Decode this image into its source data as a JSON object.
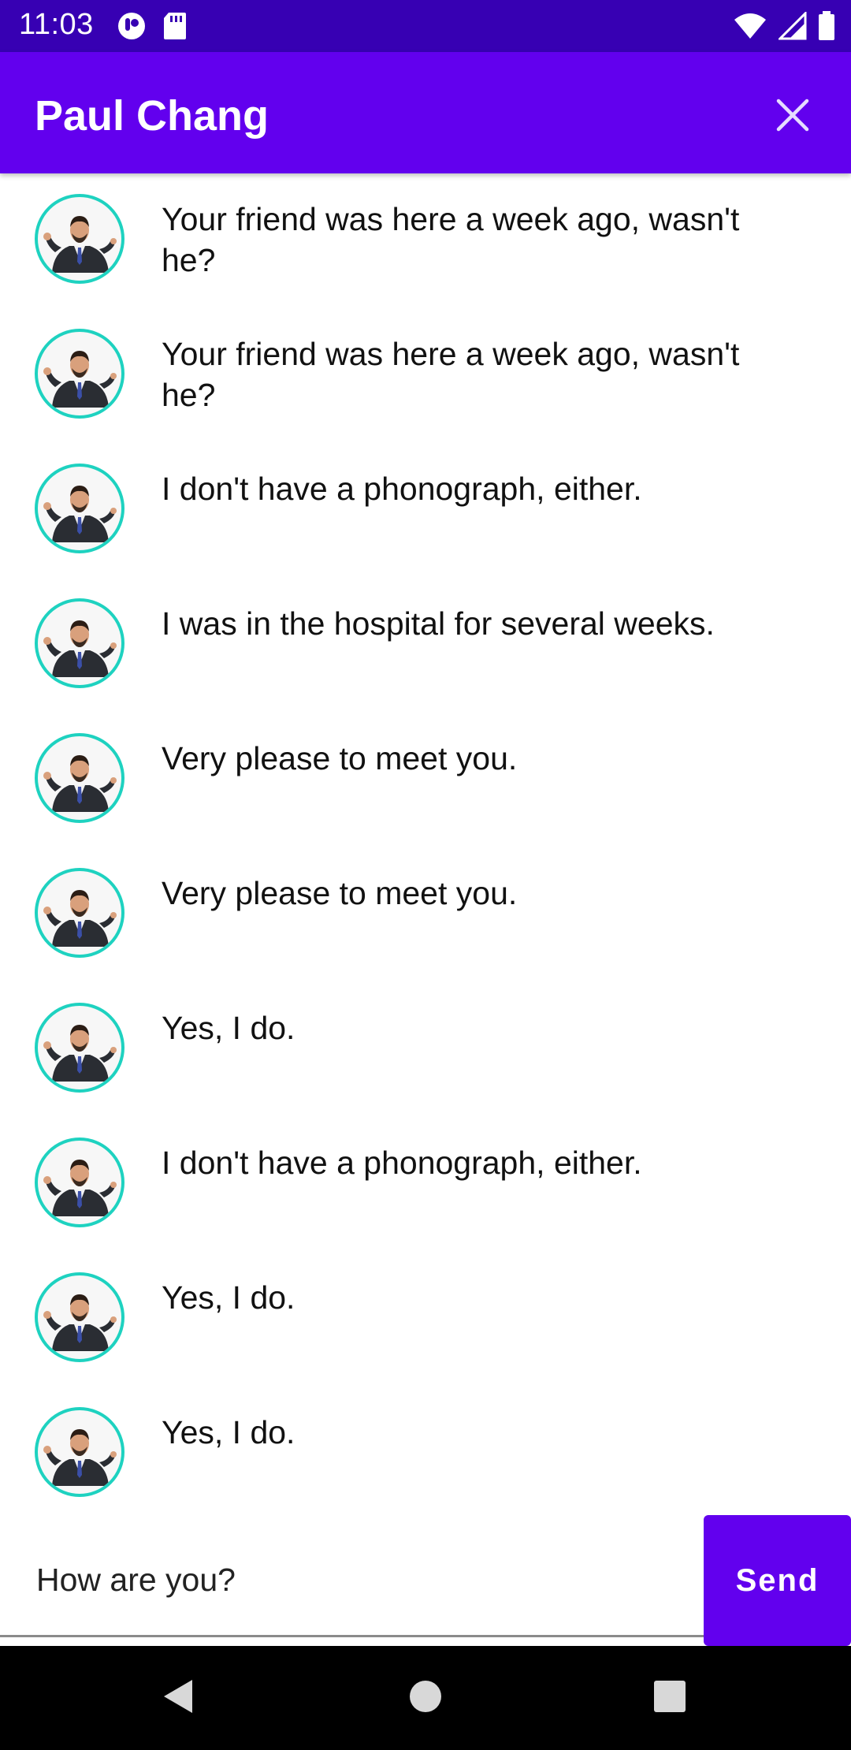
{
  "status_bar": {
    "time": "11:03",
    "left_icons": [
      "notification-app-icon",
      "sd-card-icon"
    ],
    "right_icons": [
      "wifi-icon",
      "signal-icon",
      "battery-icon"
    ]
  },
  "app_bar": {
    "title": "Paul Chang",
    "close_icon": "close-icon",
    "color": "#6200EE"
  },
  "messages": [
    {
      "text": "Your friend was here a week ago, wasn't he?"
    },
    {
      "text": "Your friend was here a week ago, wasn't he?"
    },
    {
      "text": "I don't have a phonograph, either."
    },
    {
      "text": "I was in the hospital for several weeks."
    },
    {
      "text": "Very please to meet you."
    },
    {
      "text": "Very please to meet you."
    },
    {
      "text": "Yes, I do."
    },
    {
      "text": "I don't have a phonograph, either."
    },
    {
      "text": "Yes, I do."
    },
    {
      "text": "Yes, I do."
    }
  ],
  "composer": {
    "value": "How are you?",
    "send_label": "Send"
  },
  "nav_bar": {
    "icons": [
      "back-icon",
      "home-icon",
      "recents-icon"
    ]
  },
  "colors": {
    "primary": "#6200EE",
    "status_bar": "#3700B3",
    "avatar_ring": "#1ed2c0"
  }
}
